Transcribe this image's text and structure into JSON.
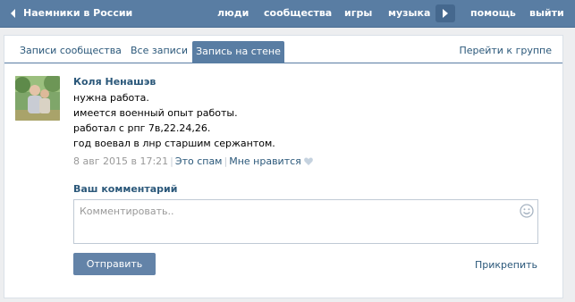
{
  "topbar": {
    "community_title": "Наемники в России",
    "nav": {
      "people": "люди",
      "communities": "сообщества",
      "games": "игры",
      "music": "музыка",
      "help": "помощь",
      "logout": "выйти"
    }
  },
  "tabs": {
    "community_posts": "Записи сообщества",
    "all_posts": "Все записи",
    "wall_post": "Запись на стене",
    "go_to_group": "Перейти к группе"
  },
  "post": {
    "author": "Коля Ненашэв",
    "lines": [
      "нужна работа.",
      "имеется военный опыт работы.",
      "работал с рпг 7в,22.24,26.",
      "год воевал в лнр старшим сержантом."
    ],
    "date": "8 авг 2015 в 17:21",
    "spam_label": "Это спам",
    "like_label": "Мне нравится"
  },
  "comment": {
    "title": "Ваш комментарий",
    "placeholder": "Комментировать..",
    "send_label": "Отправить",
    "attach_label": "Прикрепить"
  },
  "colors": {
    "header_bg": "#597da3",
    "link": "#2b587a",
    "button": "#6383a8"
  },
  "icons": [
    "back-arrow-icon",
    "play-icon",
    "heart-icon",
    "smiley-icon"
  ]
}
